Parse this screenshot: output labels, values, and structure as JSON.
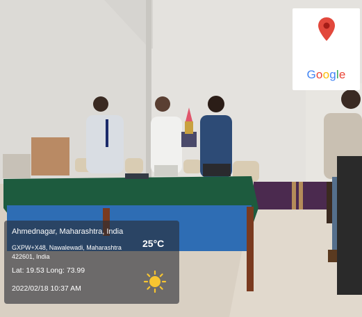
{
  "geotag": {
    "location_title": "Ahmednagar, Maharashtra, India",
    "address_line1": "GXPW+X48, Nawalewadi, Maharashtra",
    "address_line2": "422601, India",
    "coordinates": "Lat: 19.53 Long: 73.99",
    "datetime": "2022/02/18 10:37 AM",
    "temperature": "25°C",
    "weather_icon": "sun-icon"
  },
  "maps_badge": {
    "logo_text": "Google",
    "pin_icon": "map-pin-icon"
  },
  "colors": {
    "tablecloth": "#1d5b3e",
    "table_front": "#2e6db4",
    "bench": "#4b2a4f",
    "pin_red": "#e2483c"
  }
}
